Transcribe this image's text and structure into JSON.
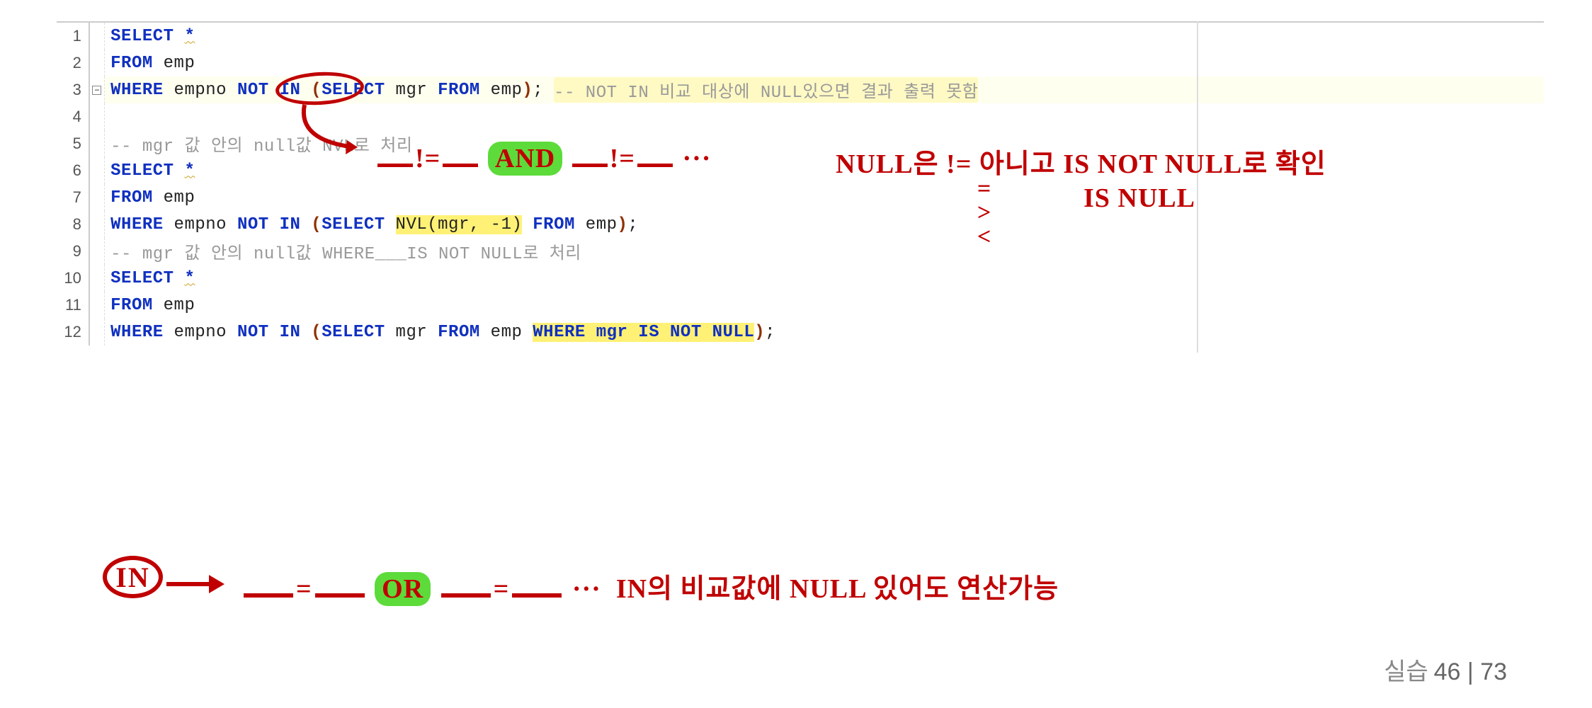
{
  "code": {
    "line1": {
      "kw1": "SELECT",
      "star": "*"
    },
    "line2": {
      "kw1": "FROM",
      "tbl": " emp"
    },
    "line3": {
      "kw1": "WHERE",
      "col": " empno ",
      "notin": "NOT IN",
      "p1": " (",
      "kw2": "SELECT",
      "col2": " mgr ",
      "kw3": "FROM",
      "tbl2": " emp",
      "p2": ")",
      "semi": "; ",
      "comment": "-- NOT IN 비교 대상에 NULL있으면 결과 출력 못함"
    },
    "line4": "",
    "line5": {
      "comment": "-- mgr 값 안의 null값 NVL로 처리"
    },
    "line6": {
      "kw1": "SELECT",
      "star": "*"
    },
    "line7": {
      "kw1": "FROM",
      "tbl": " emp"
    },
    "line8": {
      "kw1": "WHERE",
      "col": " empno ",
      "kw2": "NOT IN",
      "p1": " (",
      "kw3": "SELECT",
      "sp": " ",
      "nvl": "NVL(mgr, -1)",
      "sp2": " ",
      "kw4": "FROM",
      "tbl2": " emp",
      "p2": ")",
      "semi": ";"
    },
    "line9": {
      "comment": "-- mgr 값 안의 null값 WHERE___IS NOT NULL로 처리"
    },
    "line10": {
      "kw1": "SELECT",
      "star": "*"
    },
    "line11": {
      "kw1": "FROM",
      "tbl": " emp"
    },
    "line12": {
      "kw1": "WHERE",
      "col": " empno ",
      "kw2": "NOT IN",
      "p1": " (",
      "kw3": "SELECT",
      "col2": " mgr ",
      "kw4": "FROM",
      "tbl2": " emp ",
      "where_clause": "WHERE mgr IS NOT NULL",
      "p2": ")",
      "semi": ";"
    }
  },
  "line_numbers": [
    "1",
    "2",
    "3",
    "4",
    "5",
    "6",
    "7",
    "8",
    "9",
    "10",
    "11",
    "12"
  ],
  "annotations": {
    "not_in_explain_and": "AND",
    "not_in_explain_dots": "···",
    "null_is_not_null": "NULL은 != 아니고 IS NOT NULL로 확인",
    "null_is_null_ops": "=\n>\n<",
    "null_is_null": "IS NULL",
    "in_label": "IN",
    "or": "OR",
    "in_dots": "···",
    "in_explain": "IN의 비교값에 NULL 있어도 연산가능",
    "ne1": "!=",
    "ne2": "!=",
    "eq1": "=",
    "eq2": "="
  },
  "footer": {
    "label": "실습",
    "page": "46 | 73"
  }
}
